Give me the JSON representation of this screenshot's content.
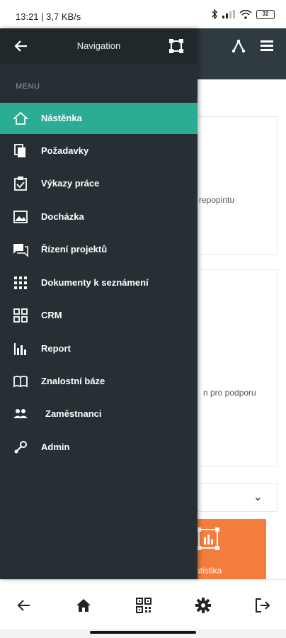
{
  "status_bar": {
    "time": "13:21 | 3,7 KB/s",
    "battery": "32"
  },
  "background": {
    "card1_text": "repopintu",
    "card2_text": "n pro podporu",
    "tile_label": "atistika"
  },
  "drawer": {
    "title": "Navigation",
    "menu_caption": "MENU",
    "items": [
      {
        "label": "Nástěnka",
        "icon": "home-icon",
        "active": true
      },
      {
        "label": "Požadavky",
        "icon": "copy-icon"
      },
      {
        "label": "Výkazy práce",
        "icon": "clipboard-icon"
      },
      {
        "label": "Docházka",
        "icon": "image-icon"
      },
      {
        "label": "Řízení projektů",
        "icon": "chat-icon"
      },
      {
        "label": "Dokumenty k seznámení",
        "icon": "grid-icon"
      },
      {
        "label": "CRM",
        "icon": "widgets-icon"
      },
      {
        "label": "Report",
        "icon": "bar-chart-icon"
      },
      {
        "label": "Znalostní báze",
        "icon": "book-icon"
      },
      {
        "label": "Zaměstnanci",
        "icon": "people-icon"
      },
      {
        "label": "Admin",
        "icon": "key-icon"
      }
    ]
  },
  "bottom_bar": {
    "icons": [
      "back-arrow-icon",
      "home-icon",
      "qr-code-icon",
      "gear-icon",
      "logout-icon"
    ]
  },
  "colors": {
    "drawer_bg": "#262f33",
    "active_item": "#2aac95",
    "header": "#2f3b40",
    "tile": "#f47c3c"
  }
}
